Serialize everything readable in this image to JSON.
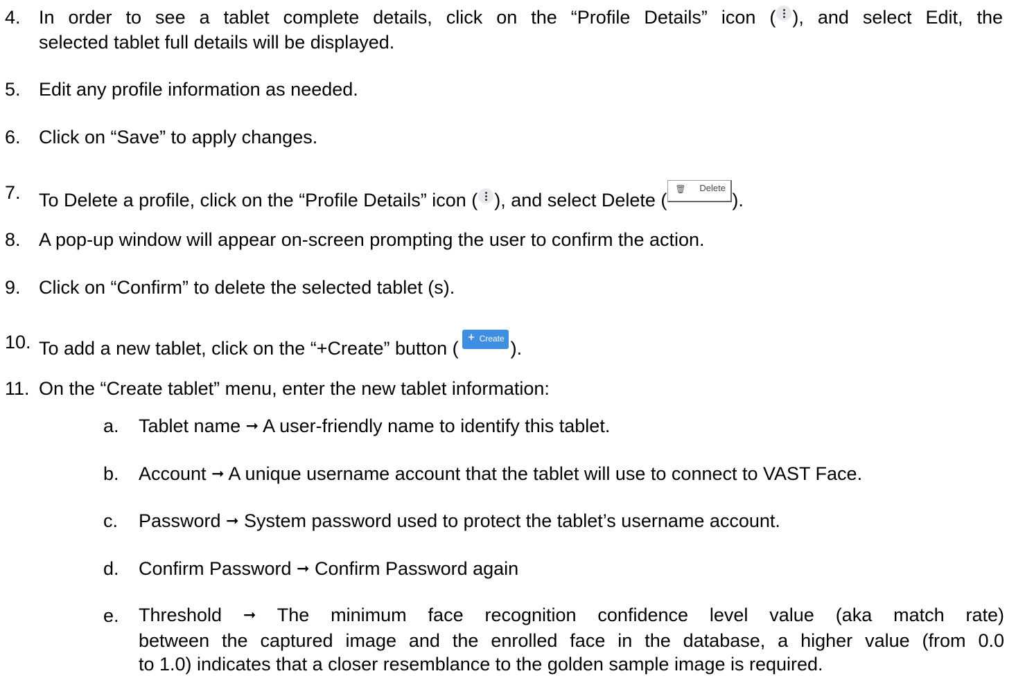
{
  "steps": [
    {
      "number": "4.",
      "line1_before": "In order to see a tablet complete details, click on the “Profile Details” icon (",
      "line1_after": "), and select Edit, the",
      "line2": "selected tablet full details will be displayed."
    },
    {
      "number": "5.",
      "text": "Edit any profile information as needed."
    },
    {
      "number": "6.",
      "text": "Click on “Save” to apply changes."
    },
    {
      "number": "7.",
      "text_before": "To Delete a profile, click on the “Profile Details” icon (",
      "text_middle": "), and select Delete (",
      "text_after": ")."
    },
    {
      "number": "8.",
      "text": "A pop-up window will appear on-screen prompting the user to confirm the action."
    },
    {
      "number": "9.",
      "text": "Click on “Confirm” to delete the selected tablet (s)."
    },
    {
      "number": "10.",
      "text_before": "To add a new tablet, click on the “+Create” button (",
      "text_after": ")."
    },
    {
      "number": "11.",
      "text": "On the “Create tablet” menu, enter the new tablet information:"
    }
  ],
  "substeps": [
    {
      "letter": "a.",
      "term": "Tablet name",
      "desc": "A user-friendly name to identify this tablet."
    },
    {
      "letter": "b.",
      "term": "Account",
      "desc": "A unique username account that the tablet will use to connect to VAST Face."
    },
    {
      "letter": "c.",
      "term": "Password",
      "desc": "System password used to protect the tablet’s username account."
    },
    {
      "letter": "d.",
      "term": "Confirm Password",
      "desc": "Confirm Password again"
    },
    {
      "letter": "e.",
      "term": "Threshold",
      "desc_line1": "The minimum face recognition confidence level value (aka match rate)",
      "desc_line2": "between the captured image and the enrolled face in the database, a higher value (from 0.0",
      "desc_line3": "to 1.0) indicates that a closer resemblance to the golden sample image is required."
    }
  ],
  "arrow_glyph": "➞",
  "icons": {
    "profile_details": "vertical-dots-icon",
    "delete": "trash-icon",
    "create": "plus-icon"
  },
  "buttons": {
    "delete_label": "Delete",
    "create_label": "Create",
    "create_plus": "+"
  },
  "colors": {
    "create_button": "#3f8ee0",
    "profile_icon_bg": "#e8e8ec"
  }
}
